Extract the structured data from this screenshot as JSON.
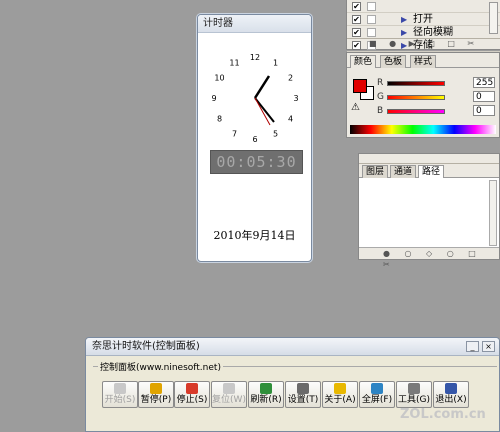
{
  "timer": {
    "title": "计时器",
    "clock_numbers": [
      "12",
      "1",
      "2",
      "3",
      "4",
      "5",
      "6",
      "7",
      "8",
      "9",
      "10",
      "11"
    ],
    "digital": "00:05:30",
    "date": "2010年9月14日"
  },
  "layers": {
    "rows": [
      {
        "check": "✔",
        "label": ""
      },
      {
        "check": "✔",
        "label": "打开"
      },
      {
        "check": "✔",
        "label": "径向模糊"
      },
      {
        "check": "✔",
        "label": "存储"
      }
    ],
    "footer": "■ ● ▶ □ □ ✂"
  },
  "color_panel": {
    "tabs": [
      "颜色",
      "色板",
      "样式"
    ],
    "channels": [
      {
        "name": "R",
        "value": "255"
      },
      {
        "name": "G",
        "value": "0"
      },
      {
        "name": "B",
        "value": "0"
      }
    ]
  },
  "paths_panel": {
    "tabs": [
      "图层",
      "通道",
      "路径"
    ],
    "footer": "● ○ ◇ ○ □ ✂"
  },
  "control": {
    "title": "奈思计时软件(控制面板)",
    "group_label": "控制面板(www.ninesoft.net)",
    "buttons": [
      {
        "label": "开始(S)",
        "icon": "play-icon",
        "disabled": true
      },
      {
        "label": "暂停(P)",
        "icon": "pause-icon",
        "disabled": false
      },
      {
        "label": "停止(S)",
        "icon": "stop-icon",
        "disabled": false
      },
      {
        "label": "复位(W)",
        "icon": "reset-icon",
        "disabled": true
      },
      {
        "label": "刷新(R)",
        "icon": "refresh-icon",
        "disabled": false
      },
      {
        "label": "设置(T)",
        "icon": "tools-icon",
        "disabled": false
      },
      {
        "label": "关于(A)",
        "icon": "help-icon",
        "disabled": false
      },
      {
        "label": "全屏(F)",
        "icon": "fullscreen-icon",
        "disabled": false
      },
      {
        "label": "工具(G)",
        "icon": "wrench-icon",
        "disabled": false
      },
      {
        "label": "退出(X)",
        "icon": "exit-icon",
        "disabled": false
      }
    ]
  },
  "watermark": "ZOL.com.cn"
}
